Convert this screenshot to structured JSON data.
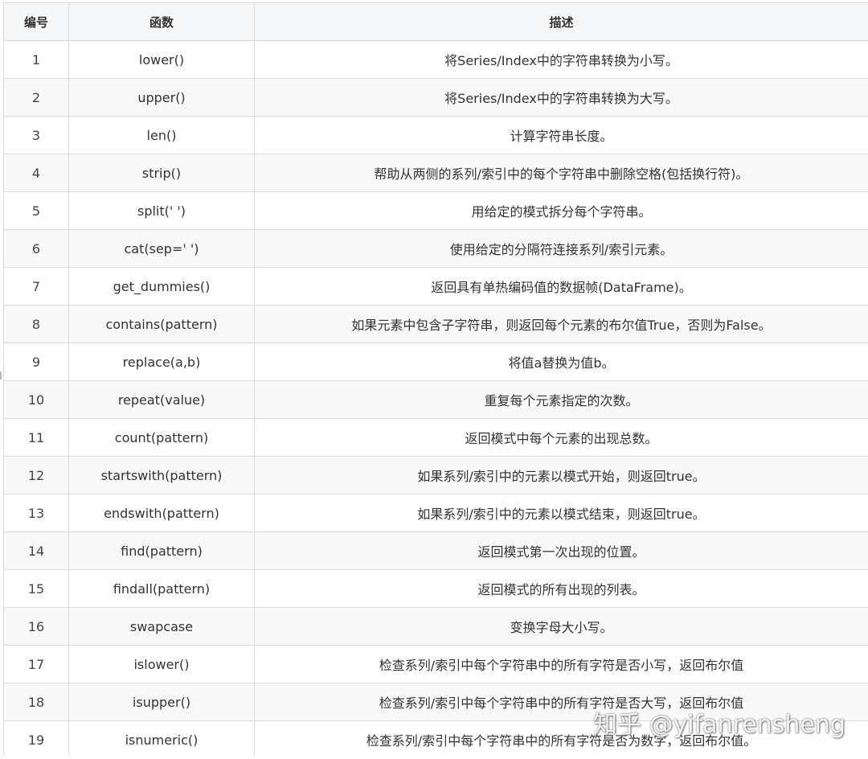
{
  "table": {
    "headers": {
      "num": "编号",
      "func": "函数",
      "desc": "描述"
    },
    "rows": [
      {
        "num": "1",
        "func": "lower()",
        "desc": "将Series/Index中的字符串转换为小写。"
      },
      {
        "num": "2",
        "func": "upper()",
        "desc": "将Series/Index中的字符串转换为大写。"
      },
      {
        "num": "3",
        "func": "len()",
        "desc": "计算字符串长度。"
      },
      {
        "num": "4",
        "func": "strip()",
        "desc": "帮助从两侧的系列/索引中的每个字符串中删除空格(包括换行符)。"
      },
      {
        "num": "5",
        "func": "split(' ')",
        "desc": "用给定的模式拆分每个字符串。"
      },
      {
        "num": "6",
        "func": "cat(sep=' ')",
        "desc": "使用给定的分隔符连接系列/索引元素。"
      },
      {
        "num": "7",
        "func": "get_dummies()",
        "desc": "返回具有单热编码值的数据帧(DataFrame)。"
      },
      {
        "num": "8",
        "func": "contains(pattern)",
        "desc": "如果元素中包含子字符串，则返回每个元素的布尔值True，否则为False。"
      },
      {
        "num": "9",
        "func": "replace(a,b)",
        "desc": "将值a替换为值b。"
      },
      {
        "num": "10",
        "func": "repeat(value)",
        "desc": "重复每个元素指定的次数。"
      },
      {
        "num": "11",
        "func": "count(pattern)",
        "desc": "返回模式中每个元素的出现总数。"
      },
      {
        "num": "12",
        "func": "startswith(pattern)",
        "desc": "如果系列/索引中的元素以模式开始，则返回true。"
      },
      {
        "num": "13",
        "func": "endswith(pattern)",
        "desc": "如果系列/索引中的元素以模式结束，则返回true。"
      },
      {
        "num": "14",
        "func": "find(pattern)",
        "desc": "返回模式第一次出现的位置。"
      },
      {
        "num": "15",
        "func": "findall(pattern)",
        "desc": "返回模式的所有出现的列表。"
      },
      {
        "num": "16",
        "func": "swapcase",
        "desc": "变换字母大小写。"
      },
      {
        "num": "17",
        "func": "islower()",
        "desc": "检查系列/索引中每个字符串中的所有字符是否小写，返回布尔值"
      },
      {
        "num": "18",
        "func": "isupper()",
        "desc": "检查系列/索引中每个字符串中的所有字符是否大写，返回布尔值"
      },
      {
        "num": "19",
        "func": "isnumeric()",
        "desc": "检查系列/索引中每个字符串中的所有字符是否为数字，返回布尔值。"
      }
    ]
  },
  "watermark": {
    "text": "知乎 @yifanrensheng"
  }
}
